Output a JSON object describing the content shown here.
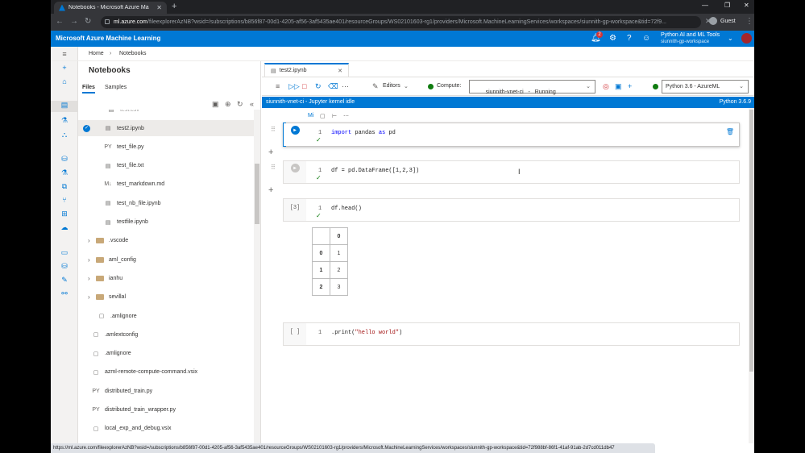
{
  "browser": {
    "tab_title": "Notebooks - Microsoft Azure Ma",
    "url_host": "ml.azure.com",
    "url_rest": "/fileexplorerAzNB?wsid=/subscriptions/b856f87-00d1-4205-af56-3af5435ae401/resourceGroups/WS02101603-rg1/providers/Microsoft.MachineLearningServices/workspaces/siunnith-gp-workspace&tid=72f9...",
    "guest_label": "Guest"
  },
  "header": {
    "brand": "Microsoft Azure Machine Learning",
    "notification_count": "2",
    "workspace_name": "Python AI and ML Tools",
    "workspace_sub": "siunnith-gp-workspace"
  },
  "breadcrumb": {
    "home": "Home",
    "current": "Notebooks"
  },
  "explorer": {
    "title": "Notebooks",
    "tabs": [
      "Files",
      "Samples"
    ],
    "partial_item": "test.csv",
    "items": [
      {
        "icon": "notebook-icon",
        "glyph": "▤",
        "label": "test2.ipynb",
        "selected": true
      },
      {
        "icon": "python-icon",
        "glyph": "PY",
        "label": "test_file.py"
      },
      {
        "icon": "text-file-icon",
        "glyph": "▤",
        "label": "test_file.txt"
      },
      {
        "icon": "markdown-icon",
        "glyph": "M↓",
        "label": "test_markdown.md"
      },
      {
        "icon": "notebook-icon",
        "glyph": "▤",
        "label": "test_nb_file.ipynb"
      },
      {
        "icon": "notebook-icon",
        "glyph": "▤",
        "label": "testfile.ipynb"
      }
    ],
    "folders": [
      ".vscode",
      "aml_config",
      "ianhu",
      "sevillal"
    ],
    "root_items": [
      {
        "icon": "file-icon",
        "glyph": "▢",
        "label": ".amlignore",
        "indent": 1
      },
      {
        "icon": "file-icon",
        "glyph": "▢",
        "label": ".amlextconfig",
        "indent": 0
      },
      {
        "icon": "file-icon",
        "glyph": "▢",
        "label": ".amlignore",
        "indent": 0
      },
      {
        "icon": "file-icon",
        "glyph": "▢",
        "label": "azml-remote-compute-command.vsix",
        "indent": 0
      },
      {
        "icon": "python-icon",
        "glyph": "PY",
        "label": "distributed_train.py",
        "indent": 0
      },
      {
        "icon": "python-icon",
        "glyph": "PY",
        "label": "distributed_train_wrapper.py",
        "indent": 0
      },
      {
        "icon": "file-icon",
        "glyph": "▢",
        "label": "local_exp_and_debug.vsix",
        "indent": 0
      }
    ]
  },
  "editor": {
    "tab_label": "test2.ipynb",
    "editors_label": "Editors",
    "compute_label": "Compute:",
    "compute_value": "siunnith-vnet-ci   -   Running",
    "kernel_value": "Python 3.6 - AzureML",
    "kernel_status": "siunnith-vnet-ci - Jupyter kernel idle",
    "python_version": "Python 3.6.9",
    "markdown_toggle": "Mi"
  },
  "cells": [
    {
      "prompt": "",
      "line": "1",
      "code_kw": "import",
      "code_rest": " pandas ",
      "code_kw2": "as",
      "code_rest2": " pd",
      "done": true
    },
    {
      "prompt": "",
      "line": "1",
      "code": "df = pd.DataFrame([1,2,3])",
      "done": true
    },
    {
      "prompt": "[3]",
      "line": "1",
      "code": "df.head()",
      "done": true
    },
    {
      "prompt": "[ ]",
      "line": "1",
      "code_pre": ".print(",
      "code_str": "\"hello world\"",
      "code_post": ")",
      "done": false
    }
  ],
  "dataframe": {
    "columns": [
      "0"
    ],
    "rows": [
      {
        "index": "0",
        "value": "1"
      },
      {
        "index": "1",
        "value": "2"
      },
      {
        "index": "2",
        "value": "3"
      }
    ]
  },
  "status_url": "https://ml.azure.com/fileexplorerAzNB?wsid=/subscriptions/b856f87-00d1-4205-af56-3af5435ae401/resourceGroups/WS02101603-rg1/providers/Microsoft.MachineLearningServices/workspaces/siunnith-gp-workspace&tid=72f988bf-86f1-41af-91ab-2d7cd011db47"
}
